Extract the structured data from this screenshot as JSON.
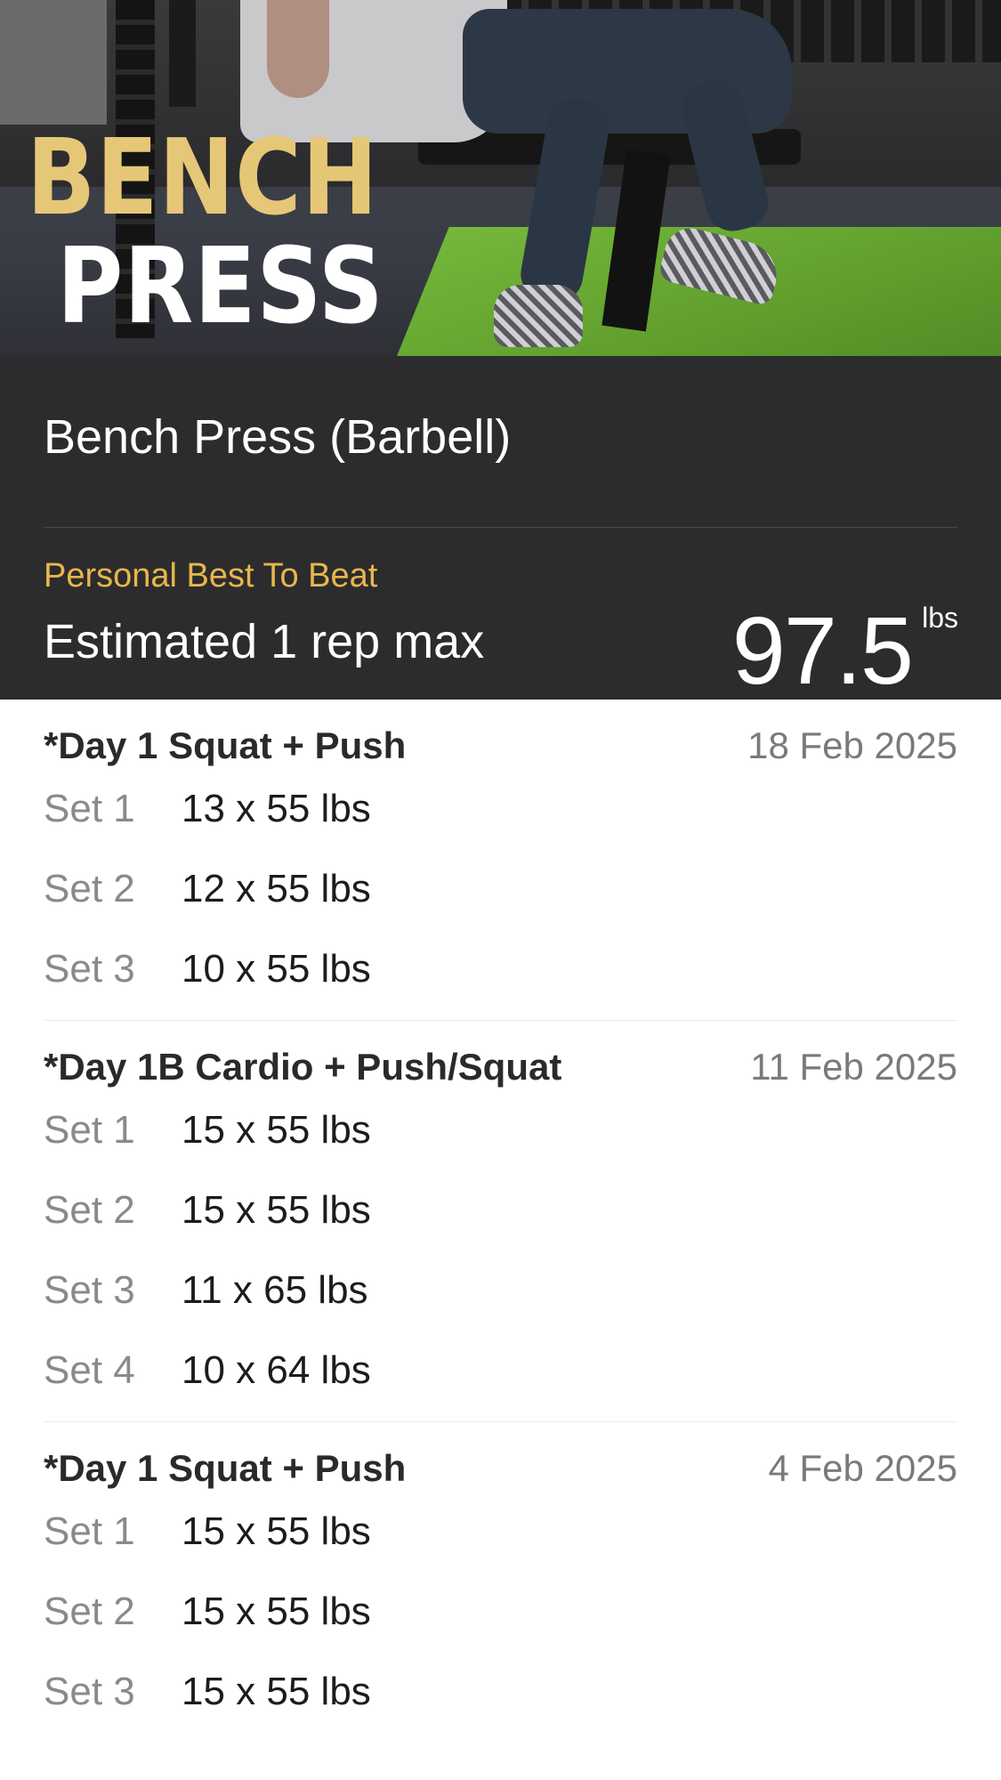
{
  "hero": {
    "title_line1": "BENCH",
    "title_line2": "PRESS"
  },
  "exercise": {
    "name": "Bench Press (Barbell)"
  },
  "personal_best": {
    "label": "Personal Best To Beat",
    "metric": "Estimated 1 rep max",
    "value": "97.5",
    "unit": "lbs"
  },
  "sessions": [
    {
      "name": "*Day 1 Squat + Push",
      "date": "18 Feb 2025",
      "sets": [
        {
          "label": "Set 1",
          "value": "13 x 55 lbs"
        },
        {
          "label": "Set 2",
          "value": "12 x 55 lbs"
        },
        {
          "label": "Set 3",
          "value": "10 x 55 lbs"
        }
      ]
    },
    {
      "name": "*Day 1B Cardio + Push/Squat",
      "date": "11 Feb 2025",
      "sets": [
        {
          "label": "Set 1",
          "value": "15 x 55 lbs"
        },
        {
          "label": "Set 2",
          "value": "15 x 55 lbs"
        },
        {
          "label": "Set 3",
          "value": "11 x 65 lbs"
        },
        {
          "label": "Set 4",
          "value": "10 x 64 lbs"
        }
      ]
    },
    {
      "name": "*Day 1 Squat + Push",
      "date": "4 Feb 2025",
      "sets": [
        {
          "label": "Set 1",
          "value": "15 x 55 lbs"
        },
        {
          "label": "Set 2",
          "value": "15 x 55 lbs"
        },
        {
          "label": "Set 3",
          "value": "15 x 55 lbs"
        }
      ]
    }
  ],
  "colors": {
    "header_bg": "#2c2c2e",
    "accent": "#e8b64c",
    "title_gold": "#e6c777"
  }
}
